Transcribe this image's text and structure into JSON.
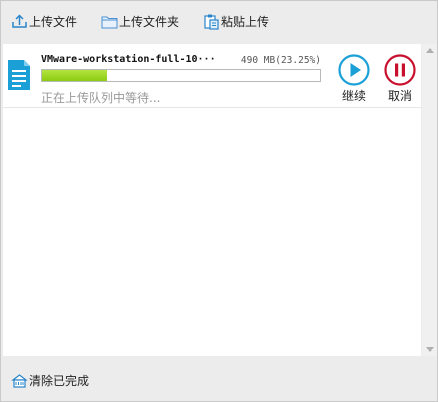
{
  "toolbar": {
    "upload_file_label": "上传文件",
    "upload_folder_label": "上传文件夹",
    "paste_upload_label": "粘贴上传"
  },
  "task": {
    "file_name": "VMware-workstation-full-10···",
    "file_size": "490 MB(23.25%)",
    "progress_fraction": 0.2325,
    "status": "正在上传队列中等待...",
    "resume_label": "继续",
    "cancel_label": "取消"
  },
  "footer": {
    "clear_completed_label": "清除已完成"
  },
  "colors": {
    "accent_blue": "#1a9fd6",
    "cancel_red": "#c8102e",
    "progress_green": "#9ed426"
  },
  "icons": {
    "upload_file": "upload-icon",
    "upload_folder": "folder-icon",
    "paste_upload": "clipboard-icon",
    "file": "document-icon",
    "resume": "play-icon",
    "cancel": "pause-icon",
    "clear": "clear-icon"
  }
}
